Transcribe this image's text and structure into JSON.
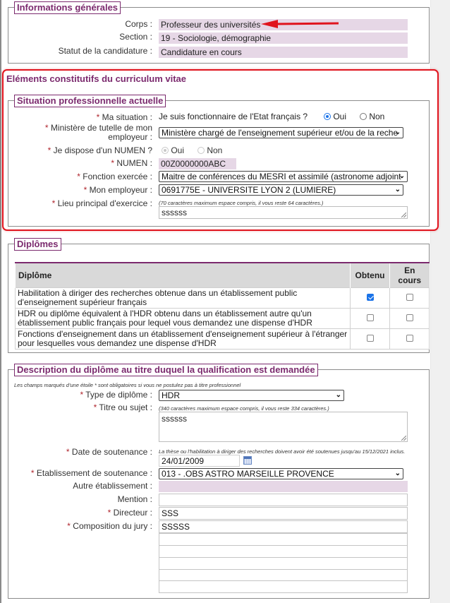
{
  "general_info": {
    "legend": "Informations générales",
    "fields": [
      {
        "label": "Corps :",
        "value": "Professeur des universités"
      },
      {
        "label": "Section :",
        "value": "19 - Sociologie, démographie"
      },
      {
        "label": "Statut de la candidature :",
        "value": "Candidature en cours"
      }
    ]
  },
  "cv_section": {
    "title": "Eléments constitutifs du curriculum vitae",
    "situation": {
      "legend": "Situation professionnelle actuelle",
      "ma_situation": {
        "label": "Ma situation :",
        "question": "Je suis fonctionnaire de l'Etat français ?",
        "options": [
          "Oui",
          "Non"
        ],
        "selected": "Oui"
      },
      "ministere": {
        "label_line1": "Ministère de tutelle de mon",
        "label_line2": "employeur :",
        "value": "Ministère chargé de l'enseignement supérieur et/ou de la reche"
      },
      "numen_question": {
        "label": "Je dispose d'un NUMEN ?",
        "options": [
          "Oui",
          "Non"
        ],
        "selected": "Oui",
        "disabled": true
      },
      "numen": {
        "label": "NUMEN :",
        "value": "00Z0000000ABC"
      },
      "fonction": {
        "label": "Fonction exercée :",
        "value": "Maitre de conférences du MESRI et assimilé (astronome adjoint"
      },
      "employeur": {
        "label": "Mon employeur :",
        "value": "0691775E - UNIVERSITE LYON 2 (LUMIERE)"
      },
      "lieu": {
        "label": "Lieu principal d'exercice :",
        "hint": "(70 caractères maximum espace compris, il vous reste 64 caractères.)",
        "value": "ssssss"
      }
    }
  },
  "diplomes": {
    "legend": "Diplômes",
    "columns": [
      "Diplôme",
      "Obtenu",
      "En cours"
    ],
    "rows": [
      {
        "text": "Habilitation à diriger des recherches obtenue dans un établissement public d'enseignement supérieur français",
        "obtenu": true,
        "en_cours": false
      },
      {
        "text": "HDR ou diplôme équivalent à l'HDR obtenu dans un établissement autre qu'un établissement public français pour lequel vous demandez une dispense d'HDR",
        "obtenu": false,
        "en_cours": false
      },
      {
        "text": "Fonctions d'enseignement dans un établissement d'enseignement supérieur à l'étranger pour lesquelles vous demandez une dispense d'HDR",
        "obtenu": false,
        "en_cours": false
      }
    ]
  },
  "description": {
    "legend": "Description du diplôme au titre duquel la qualification est demandée",
    "note": "Les champs marqués d'une étoile * sont obligatoires si vous ne postulez pas à titre professionnel",
    "type": {
      "label": "Type de diplôme :",
      "value": "HDR"
    },
    "titre": {
      "label": "Titre ou sujet :",
      "hint": "(340 caractères maximum espace compris, il vous reste 334 caractères.)",
      "value": "ssssss"
    },
    "date": {
      "label": "Date de soutenance :",
      "hint": "La thèse ou l'habilitation à diriger des recherches doivent avoir été soutenues jusqu'au 15/12/2021 inclus.",
      "value": "24/01/2009"
    },
    "etablissement": {
      "label": "Etablissement de soutenance :",
      "value": "013 - .OBS ASTRO MARSEILLE PROVENCE"
    },
    "autre": {
      "label": "Autre établissement :",
      "value": ""
    },
    "mention": {
      "label": "Mention :",
      "value": ""
    },
    "directeur": {
      "label": "Directeur :",
      "value": "SSS"
    },
    "jury": {
      "label": "Composition du jury :",
      "values": [
        "SSSSS",
        "",
        "",
        "",
        "",
        ""
      ]
    }
  },
  "required_marker": "*",
  "icons": {
    "select_chevron": "❯",
    "calendar": "calendar-icon"
  },
  "colors": {
    "accent": "#7b2a6e",
    "highlight": "#e0141e",
    "readonly_bg": "#e6d7e6",
    "checkbox_on": "#1a73e8"
  }
}
